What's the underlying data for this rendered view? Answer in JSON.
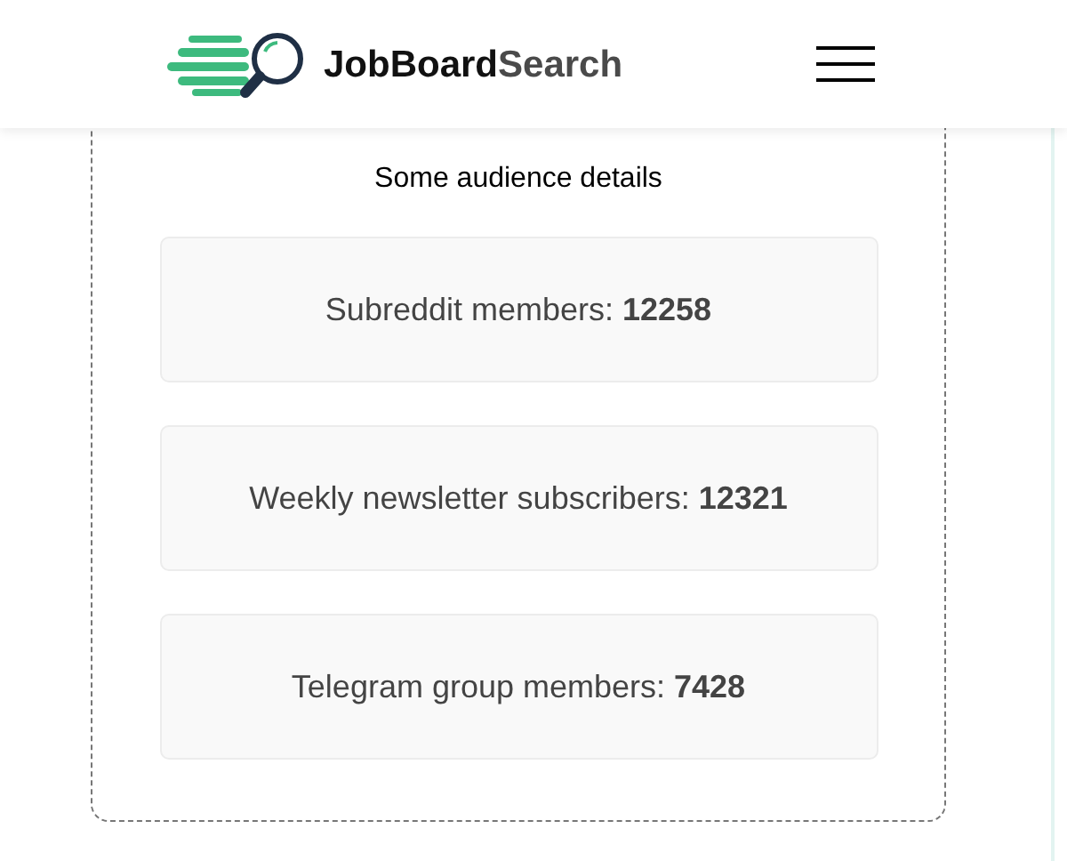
{
  "header": {
    "logo": {
      "primary": "JobBoard",
      "secondary": "Search"
    }
  },
  "audience": {
    "title": "Some audience details",
    "stats": [
      {
        "text": "Subreddit members: **12258**"
      },
      {
        "text": "Weekly newsletter subscribers: **12321**"
      },
      {
        "text": "Telegram group members: **7428**"
      }
    ]
  }
}
